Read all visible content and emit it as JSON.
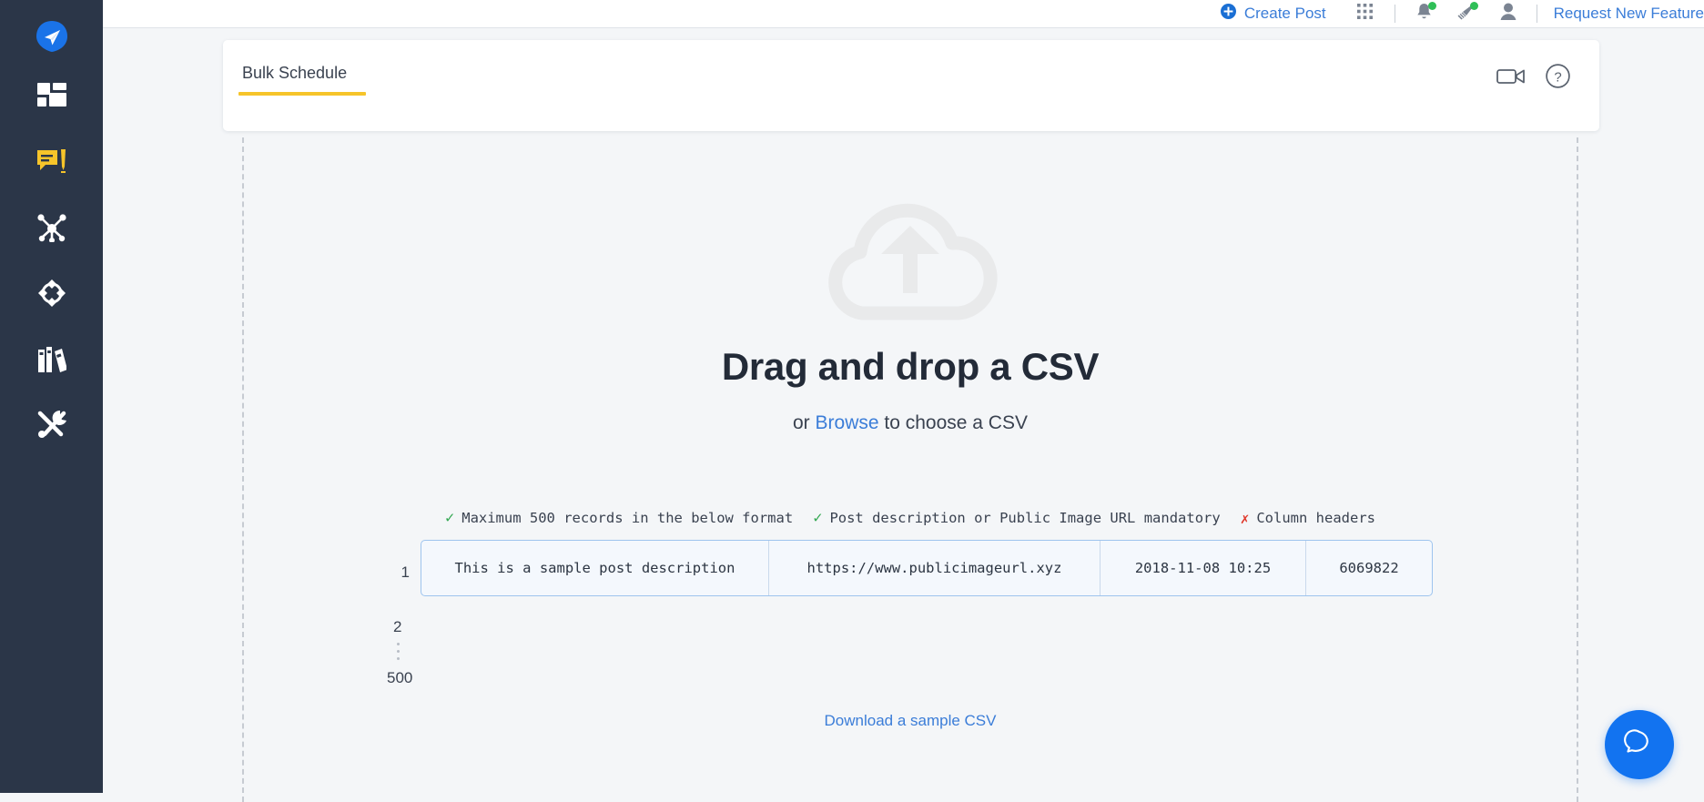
{
  "topbar": {
    "create_post_label": "Create Post",
    "request_feature_label": "Request New Feature",
    "icons": {
      "plus": "plus-circle-icon",
      "apps": "apps-grid-icon",
      "bell": "notification-bell-icon",
      "announcement": "announcement-megaphone-icon",
      "profile": "user-avatar-icon"
    },
    "accent_link_color": "#3b7dd8",
    "badge_color": "#2fbf57"
  },
  "sidebar": {
    "background": "#2b3648",
    "items": [
      {
        "name": "brand-logo",
        "icon": "paper-plane-logo"
      },
      {
        "name": "dashboard",
        "icon": "dashboard-grid-icon"
      },
      {
        "name": "publish",
        "icon": "compose-message-icon",
        "color": "#f6c42a"
      },
      {
        "name": "engage",
        "icon": "network-nodes-icon"
      },
      {
        "name": "listen",
        "icon": "target-circle-icon"
      },
      {
        "name": "library",
        "icon": "books-library-icon"
      },
      {
        "name": "tools",
        "icon": "tools-wrench-icon"
      }
    ]
  },
  "card": {
    "tab_label": "Bulk Schedule",
    "tab_underline_color": "#f6c42a",
    "actions": [
      {
        "name": "video-tutorial",
        "icon": "video-camera-icon"
      },
      {
        "name": "help",
        "icon": "question-mark-circle-icon"
      }
    ]
  },
  "dropzone": {
    "upload_icon": "cloud-upload-icon",
    "title": "Drag and drop a CSV",
    "sub_prefix": "or ",
    "browse_label": "Browse",
    "sub_suffix": " to choose a CSV",
    "rules": [
      {
        "mark": "check",
        "text": "Maximum 500 records in the below format"
      },
      {
        "mark": "check",
        "text": "Post description or Public Image URL mandatory"
      },
      {
        "mark": "cross",
        "text": "Column headers"
      }
    ],
    "sample_table": {
      "row_number_first": "1",
      "cells": [
        "This is a sample post description",
        "https://www.publicimageurl.xyz",
        "2018-11-08 10:25",
        "6069822"
      ],
      "row_number_second": "2",
      "row_number_last": "500"
    },
    "download_label": "Download a sample CSV"
  },
  "chat": {
    "icon": "chat-bubble-icon",
    "color": "#1273f0"
  }
}
